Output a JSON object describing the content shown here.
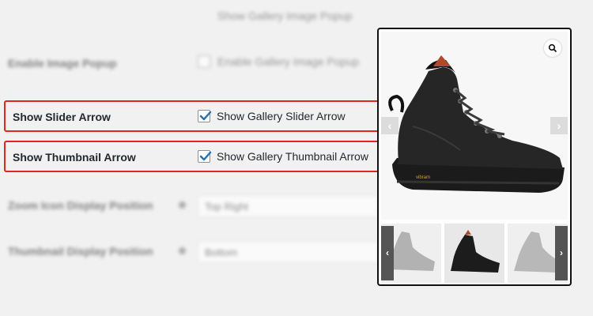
{
  "background_settings": {
    "top_label": "Show Gallery Image Popup",
    "enable_popup": {
      "label": "Enable Image Popup",
      "value": "Enable Gallery Image Popup"
    },
    "zoom_position": {
      "label": "Zoom Icon Display Position",
      "value": "Top Right"
    },
    "thumb_position": {
      "label": "Thumbnail Display Position",
      "value": "Bottom"
    }
  },
  "highlighted_settings": {
    "slider_arrow": {
      "label": "Show Slider Arrow",
      "checkbox_label": "Show Gallery Slider Arrow",
      "checked": true
    },
    "thumbnail_arrow": {
      "label": "Show Thumbnail Arrow",
      "checkbox_label": "Show Gallery Thumbnail Arrow",
      "checked": true
    }
  },
  "gallery_preview": {
    "zoom_icon": "magnifier-icon",
    "prev_arrow": "‹",
    "next_arrow": "›",
    "thumb_prev_arrow": "‹",
    "thumb_next_arrow": "›",
    "product_brand_text": "vibram"
  },
  "colors": {
    "highlight_border": "#e02424",
    "checkbox_check": "#2271b1",
    "card_border": "#111111"
  }
}
